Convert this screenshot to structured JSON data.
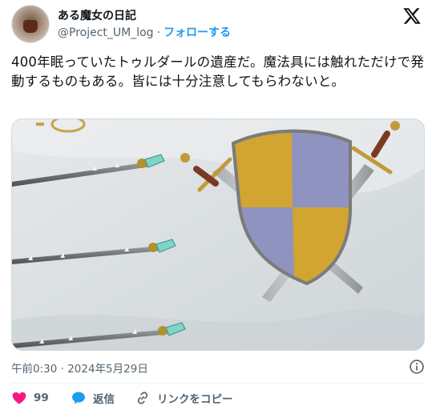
{
  "author": {
    "display_name": "ある魔女の日記",
    "handle": "@Project_UM_log",
    "separator": "·",
    "follow_label": "フォローする"
  },
  "tweet": {
    "text": "400年眠っていたトゥルダールの遺産だ。魔法具には触れただけで発動するものもある。皆には十分注意してもらわないと。"
  },
  "meta": {
    "timestamp": "午前0:30 · 2024年5月29日"
  },
  "actions": {
    "like_count": "99",
    "reply_label": "返信",
    "copy_link_label": "リンクをコピー"
  },
  "colors": {
    "accent": "#1d9bf0",
    "like": "#f91880",
    "muted": "#536471",
    "shield_blue": "#8f93bf",
    "shield_gold": "#d2a431"
  },
  "icons": {
    "brand": "x-logo-icon",
    "info": "info-icon",
    "like": "heart-icon",
    "reply": "speech-bubble-icon",
    "copy_link": "link-icon"
  }
}
